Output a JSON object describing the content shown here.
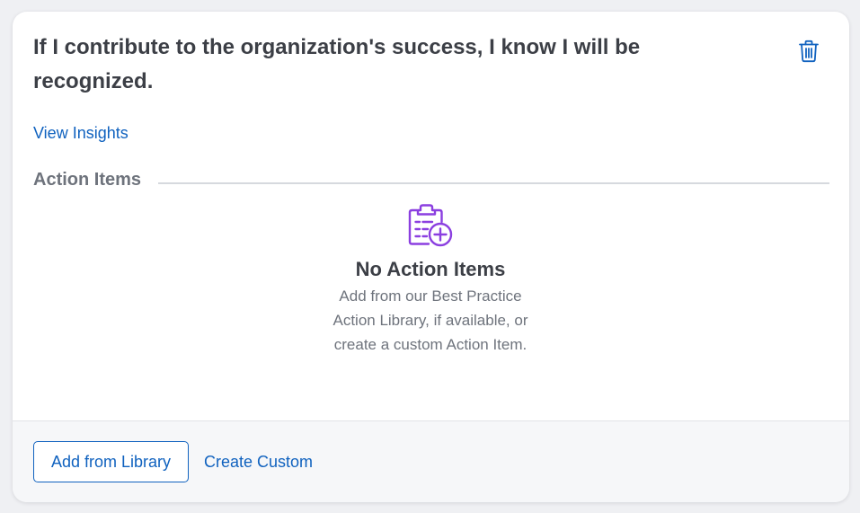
{
  "card": {
    "question": "If I contribute to the organization's success, I know I will be recognized.",
    "delete_icon": "trash-icon",
    "view_insights_label": "View Insights"
  },
  "action_items": {
    "section_title": "Action Items",
    "empty_icon": "clipboard-add-icon",
    "empty_title": "No Action Items",
    "empty_description": "Add from our Best Practice Action Library, if available, or create a custom Action Item."
  },
  "footer": {
    "add_from_library_label": "Add from Library",
    "create_custom_label": "Create Custom"
  },
  "colors": {
    "accent": "#1062bf",
    "icon_purple": "#8b3fe0",
    "heading": "#3c3f46",
    "muted": "#6e737c"
  }
}
